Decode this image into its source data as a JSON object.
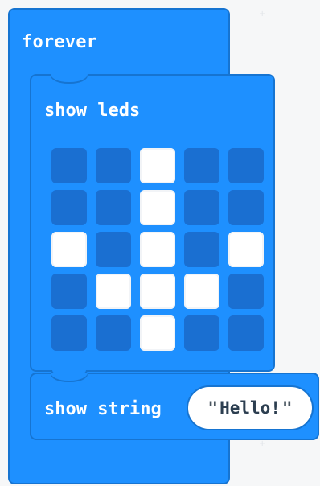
{
  "workspace": {
    "background_color": "#f6f7f8",
    "grid_mark_color": "#e1e4e8"
  },
  "blocks": {
    "forever": {
      "label": "forever",
      "color": "#1e90ff",
      "border_color": "#1674d1"
    },
    "show_leds": {
      "label": "show leds",
      "color": "#1e90ff",
      "border_color": "#1674d1",
      "led_off_color": "#1a6fd1",
      "led_on_color": "#ffffff",
      "matrix": [
        [
          0,
          0,
          1,
          0,
          0
        ],
        [
          0,
          0,
          1,
          0,
          0
        ],
        [
          1,
          0,
          1,
          0,
          1
        ],
        [
          0,
          1,
          1,
          1,
          0
        ],
        [
          0,
          0,
          1,
          0,
          0
        ]
      ]
    },
    "show_string": {
      "label": "show string",
      "open_quote": "\"",
      "value": "Hello!",
      "close_quote": "\"",
      "color": "#1e90ff",
      "border_color": "#1674d1"
    }
  }
}
